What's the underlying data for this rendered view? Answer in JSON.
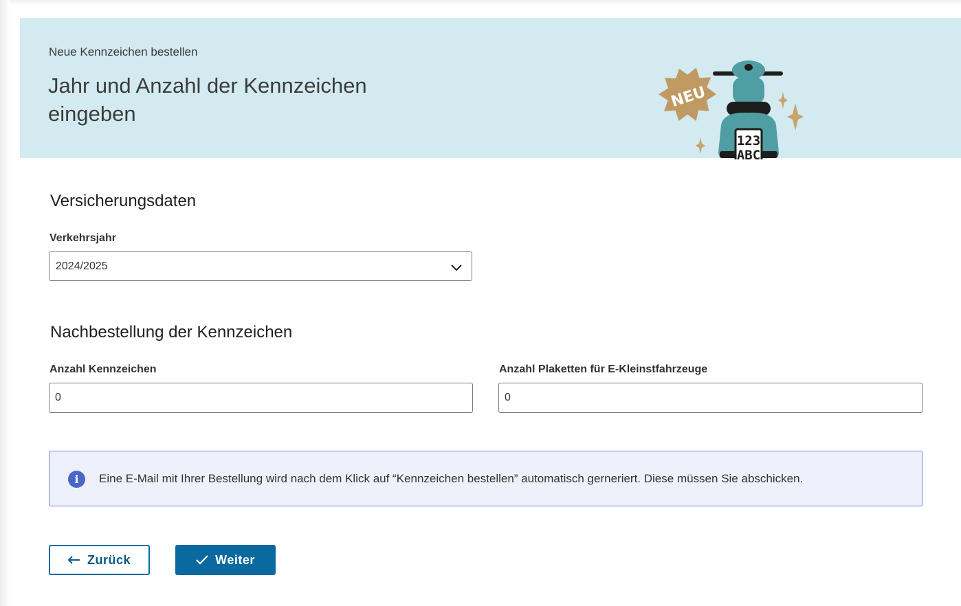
{
  "hero": {
    "eyebrow": "Neue Kennzeichen bestellen",
    "title": "Jahr und Anzahl der Kennzeichen eingeben",
    "illustration": {
      "badge": "NEU",
      "plate_line1": "123",
      "plate_line2": "ABC",
      "icon": "scooter-illustration"
    }
  },
  "insurance": {
    "section_title": "Versicherungsdaten",
    "year_label": "Verkehrsjahr",
    "year_value": "2024/2025"
  },
  "reorder": {
    "section_title": "Nachbestellung der Kennzeichen",
    "plates_label": "Anzahl Kennzeichen",
    "plates_value": "0",
    "stickers_label": "Anzahl Plaketten für E-Kleinstfahrzeuge",
    "stickers_value": "0"
  },
  "info": {
    "icon": "info-icon",
    "text": "Eine E-Mail mit Ihrer Bestellung wird nach dem Klick auf “Kennzeichen bestellen” automatisch gerneriert. Diese müssen Sie abschicken."
  },
  "actions": {
    "back_label": "Zurück",
    "next_label": "Weiter"
  },
  "colors": {
    "hero_background": "#d3eaf0",
    "primary": "#0a6aa0",
    "info_background": "#eef1fb",
    "info_border": "#6f86c9"
  }
}
